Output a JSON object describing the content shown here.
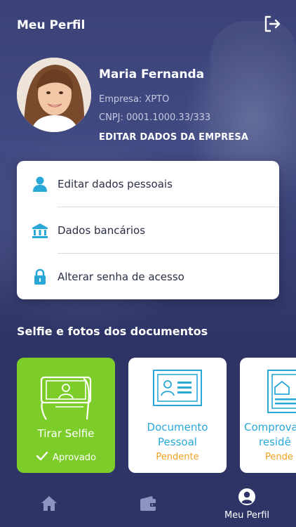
{
  "header": {
    "title": "Meu Perfil"
  },
  "profile": {
    "name": "Maria Fernanda",
    "company": "Empresa: XPTO",
    "cnpj": "CNPJ: 0001.1000.33/333",
    "edit_company_label": "EDITAR DADOS DA EMPRESA"
  },
  "menu": {
    "items": [
      {
        "label": "Editar dados pessoais",
        "icon": "person-icon"
      },
      {
        "label": "Dados bancários",
        "icon": "bank-icon"
      },
      {
        "label": "Alterar senha de acesso",
        "icon": "lock-icon"
      }
    ]
  },
  "documents": {
    "section_title": "Selfie e fotos dos documentos",
    "cards": [
      {
        "title": "Tirar Selfie",
        "status": "Aprovado",
        "icon": "selfie-icon"
      },
      {
        "title_line1": "Documento",
        "title_line2": "Pessoal",
        "status": "Pendente",
        "icon": "id-card-icon"
      },
      {
        "title_line1": "Comprova",
        "title_line2": "residê",
        "status": "Pende",
        "icon": "house-document-icon"
      }
    ]
  },
  "nav": {
    "items": [
      {
        "label": "",
        "icon": "home-icon"
      },
      {
        "label": "",
        "icon": "wallet-icon"
      },
      {
        "label": "Meu Perfil",
        "icon": "profile-icon"
      }
    ]
  },
  "colors": {
    "background": "#2e3566",
    "accent_blue": "#29a8d8",
    "approved_green": "#7ccd2a",
    "pending_orange": "#f0a020"
  }
}
